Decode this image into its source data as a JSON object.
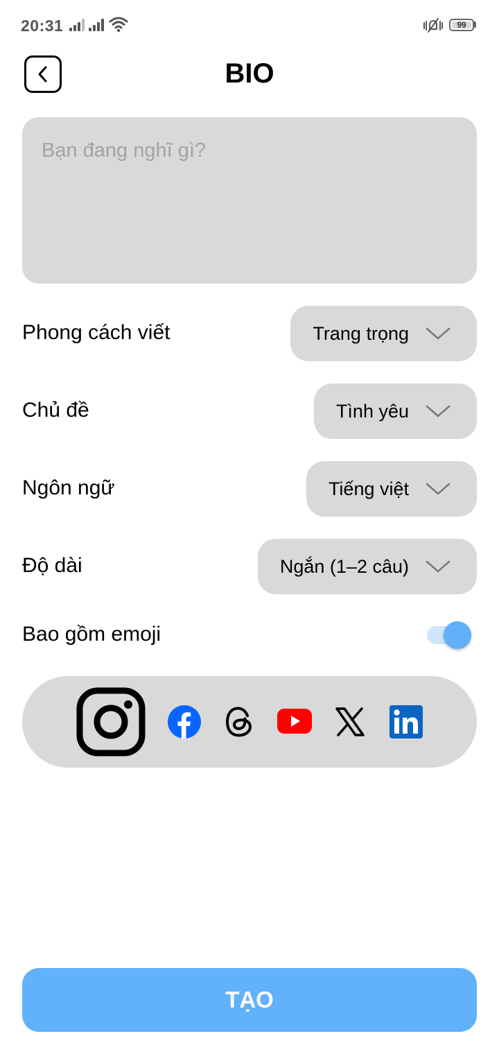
{
  "status_bar": {
    "time": "20:31",
    "battery": "99"
  },
  "header": {
    "title": "BIO",
    "back_icon": "chevron-left-icon"
  },
  "bio": {
    "placeholder": "Bạn đang nghĩ gì?",
    "value": ""
  },
  "options": {
    "writing_style": {
      "label": "Phong cách viết",
      "value": "Trang trọng"
    },
    "topic": {
      "label": "Chủ đề",
      "value": "Tình yêu"
    },
    "language": {
      "label": "Ngôn ngữ",
      "value": "Tiếng việt"
    },
    "length": {
      "label": "Độ dài",
      "value": "Ngắn (1–2 câu)"
    },
    "emoji": {
      "label": "Bao gồm emoji",
      "enabled": true
    }
  },
  "social": {
    "selected": "instagram",
    "platforms": [
      "instagram",
      "facebook",
      "threads",
      "youtube",
      "x",
      "linkedin"
    ]
  },
  "colors": {
    "primary": "#62b1fb",
    "field_bg": "#d9d9d9",
    "facebook": "#0866ff",
    "youtube": "#ff0000",
    "linkedin": "#0a66c2"
  },
  "create_button": {
    "label": "TẠO"
  }
}
